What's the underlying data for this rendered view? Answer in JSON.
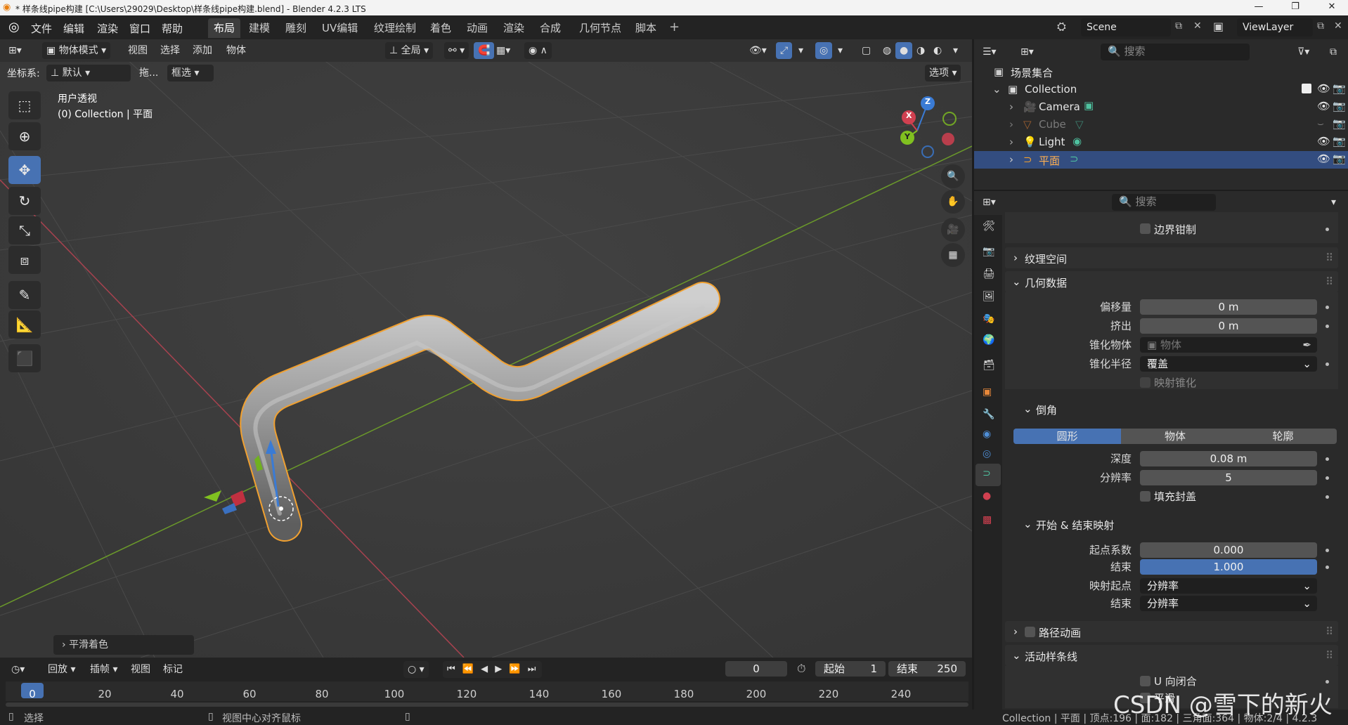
{
  "window": {
    "title": "* 样条线pipe构建 [C:\\Users\\29029\\Desktop\\样条线pipe构建.blend] - Blender 4.2.3 LTS",
    "buttons": [
      "—",
      "❐",
      "✕"
    ]
  },
  "menu": {
    "items": [
      "文件",
      "编辑",
      "渲染",
      "窗口",
      "帮助"
    ]
  },
  "workspaces": [
    "布局",
    "建模",
    "雕刻",
    "UV编辑",
    "纹理绘制",
    "着色",
    "动画",
    "渲染",
    "合成",
    "几何节点",
    "脚本"
  ],
  "scene": {
    "name": "Scene",
    "view_layer": "ViewLayer"
  },
  "viewport_header": {
    "mode": "物体模式",
    "menus": [
      "视图",
      "选择",
      "添加",
      "物体"
    ],
    "transform": "全局",
    "coord_label": "坐标系:",
    "coord_value": "默认",
    "drag_label": "拖...",
    "select_mode": "框选",
    "options": "选项"
  },
  "viewport": {
    "view_name": "用户透视",
    "collection_line": "(0) Collection | 平面",
    "last_op": "平滑着色",
    "gizmo": {
      "x": "X",
      "y": "Y",
      "z": "Z"
    }
  },
  "outliner": {
    "search_placeholder": "搜索",
    "root": "场景集合",
    "collection": "Collection",
    "objects": [
      {
        "name": "Camera",
        "selected": false,
        "dim": false
      },
      {
        "name": "Cube",
        "selected": false,
        "dim": true
      },
      {
        "name": "Light",
        "selected": false,
        "dim": false
      },
      {
        "name": "平面",
        "selected": true,
        "dim": false
      }
    ]
  },
  "properties": {
    "search_placeholder": "搜索",
    "top_partial": "边界钳制",
    "texture_space": "纹理空间",
    "geometry": {
      "title": "几何数据",
      "offset_label": "偏移量",
      "offset_value": "0 m",
      "extrude_label": "挤出",
      "extrude_value": "0 m",
      "taper_obj_label": "锥化物体",
      "taper_obj_placeholder": "物体",
      "taper_radius_label": "锥化半径",
      "taper_radius_value": "覆盖",
      "map_taper": "映射锥化"
    },
    "bevel": {
      "title": "倒角",
      "modes": [
        "圆形",
        "物体",
        "轮廓"
      ],
      "depth_label": "深度",
      "depth_value": "0.08 m",
      "resolution_label": "分辨率",
      "resolution_value": "5",
      "fill_caps": "填充封盖"
    },
    "mapping": {
      "title": "开始 & 结束映射",
      "start_label": "起点系数",
      "start_value": "0.000",
      "end_label": "结束",
      "end_value": "1.000",
      "map_start_label": "映射起点",
      "map_start_value": "分辨率",
      "map_end_label": "结束",
      "map_end_value": "分辨率"
    },
    "path_anim": "路径动画",
    "active_spline": {
      "title": "活动样条线",
      "cyclic_u": "U 向闭合",
      "smooth": "平滑"
    }
  },
  "timeline": {
    "menus": [
      "回放",
      "插帧",
      "视图",
      "标记"
    ],
    "current_frame": "0",
    "start_label": "起始",
    "start_value": "1",
    "end_label": "结束",
    "end_value": "250",
    "ticks": [
      "0",
      "20",
      "40",
      "60",
      "80",
      "100",
      "120",
      "140",
      "160",
      "180",
      "200",
      "220",
      "240"
    ]
  },
  "status": {
    "select": "选择",
    "center": "视图中心对齐鼠标",
    "stats": "Collection | 平面 | 顶点:196 | 面:182 | 三角面:364 | 物体:2/4 | 4.2.3"
  },
  "watermark": "CSDN @雪下的新火",
  "colors": {
    "accent": "#4772b3",
    "selection_outline": "#f0a030",
    "x_axis": "#d04050",
    "y_axis": "#80c020",
    "z_axis": "#3a7bd5"
  }
}
